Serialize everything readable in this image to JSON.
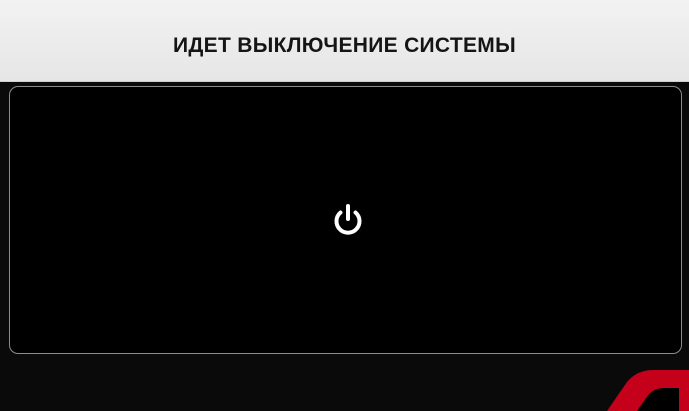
{
  "window": {
    "title": "ИДЕТ ВЫКЛЮЧЕНИЕ СИСТЕМЫ"
  },
  "dialog": {
    "icon": "power-icon"
  },
  "colors": {
    "title_background": "#e9e9e9",
    "title_text": "#151515",
    "screen_background": "#0a0a0a",
    "panel_background": "#000000",
    "panel_border": "#8c8c8c",
    "icon": "#ffffff",
    "watermark": "#c4001b"
  }
}
